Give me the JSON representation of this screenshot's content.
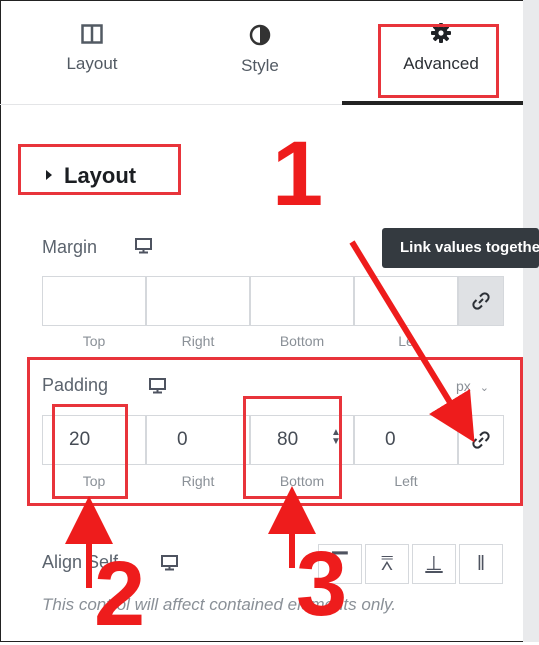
{
  "tabs": [
    {
      "label": "Layout",
      "icon": "columns-icon"
    },
    {
      "label": "Style",
      "icon": "half-circle-icon"
    },
    {
      "label": "Advanced",
      "icon": "gear-icon"
    }
  ],
  "section": {
    "title": "Layout"
  },
  "margin": {
    "label": "Margin",
    "values": [
      "",
      "",
      "",
      ""
    ],
    "sides": [
      "Top",
      "Right",
      "Bottom",
      "Left"
    ],
    "left_side_visible": "Le"
  },
  "tooltip": "Link values together",
  "padding": {
    "label": "Padding",
    "unit": "px",
    "values": [
      "20",
      "0",
      "80",
      "0"
    ],
    "sides": [
      "Top",
      "Right",
      "Bottom",
      "Left"
    ]
  },
  "align": {
    "label": "Align Self"
  },
  "note": "This control will affect contained elements only.",
  "callouts": [
    "1",
    "2",
    "3"
  ],
  "colors": {
    "annotation_red": "#e8343b",
    "callout_red": "#ee1c1c",
    "tooltip_bg": "#343a40"
  }
}
